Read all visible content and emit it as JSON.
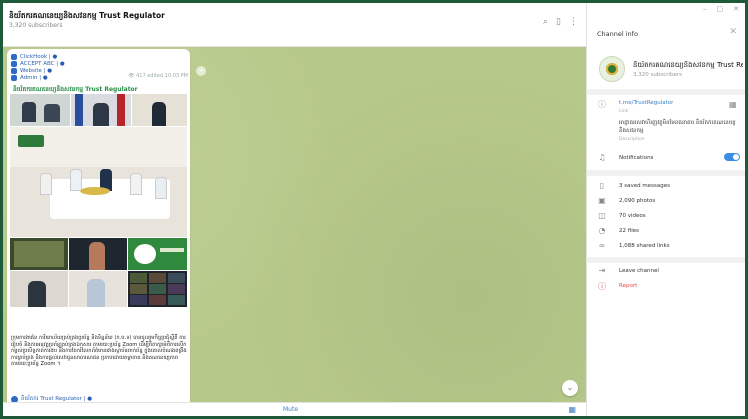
{
  "window_controls": [
    "–",
    "▢",
    "✕"
  ],
  "chat": {
    "title": " និយ័តករគណនេយ្យនិងសវនកម្ម Trust Regulator",
    "subscribers": "3,320 subscribers",
    "header_icons": [
      "search-icon",
      "sidebar-toggle-icon",
      "more-icon"
    ]
  },
  "message": {
    "reply_lines": [
      "ClickHook | ●",
      "ACCEPT ABC | ●",
      "Website | ●",
      "Admin | ●"
    ],
    "views": "👁 417  edited 10:03 PM",
    "sender": "និយ័តករគណនេយ្យនិងសវនកម្ម Trust Regulator",
    "caption": "ក្រុមការងារនៃ ការិយាល័យគ្រប់គ្រងប្រព័ន្ធ និងទិន្នន័យ (ក.ប.ទ) បានចូលរួមកិច្ចប្រជុំស្តីពី ការរៀបចំ និងការអនុវត្តប្រព័ន្ធគ្រប់គ្រងឯកសារ តាមរយៈប្រព័ន្ធ Zoom ដើម្បីពិភាក្សាអំពីការលើកកម្ពស់ប្រសិទ្ធភាពការងារ និងការចែករំលែកព័ត៌មានរវាងស្ថាប័នពាក់ព័ន្ធ ក្នុងគោលបំណងពង្រឹងការគ្រប់គ្រង និងការផ្តល់សេវាជូនសាធារណជន ប្រកបដោយតម្លាភាព និងគណនេយ្យភាព តាមរយៈប្រព័ន្ធ Zoom ។",
    "footer_sender": "និយ័តករ Trust Regulator | ●"
  },
  "footer": {
    "mute_label": "Mute"
  },
  "info_panel": {
    "title": "Channel info",
    "name": "និយ័តករគណនេយ្យនិងសវនកម្ម Trust Regu...",
    "subscribers": "3,320 subscribers",
    "link": "t.me/TrustRegulator",
    "link_label": "Link",
    "description": "អាជ្ញាធរសេវាហិរញ្ញវត្ថុមិនមែនធនាគារ និយ័តករគណនេយ្យនិងសវនកម្ម",
    "description_label": "Description",
    "notifications_label": "Notifications",
    "notifications_on": true,
    "media_rows": [
      {
        "icon": "bookmark-icon",
        "label": "3 saved messages"
      },
      {
        "icon": "photo-icon",
        "label": "2,090 photos"
      },
      {
        "icon": "video-icon",
        "label": "70 videos"
      },
      {
        "icon": "file-icon",
        "label": "22 files"
      },
      {
        "icon": "link-icon",
        "label": "1,088 shared links"
      }
    ],
    "leave_label": "Leave channel",
    "report_label": "Report"
  },
  "colors": {
    "accent": "#3a7fc4",
    "chat_background": "#b7c98a",
    "sender_green": "#2a8c4a",
    "report_red": "#e04b4b",
    "window_frame": "#1e5a3a"
  }
}
